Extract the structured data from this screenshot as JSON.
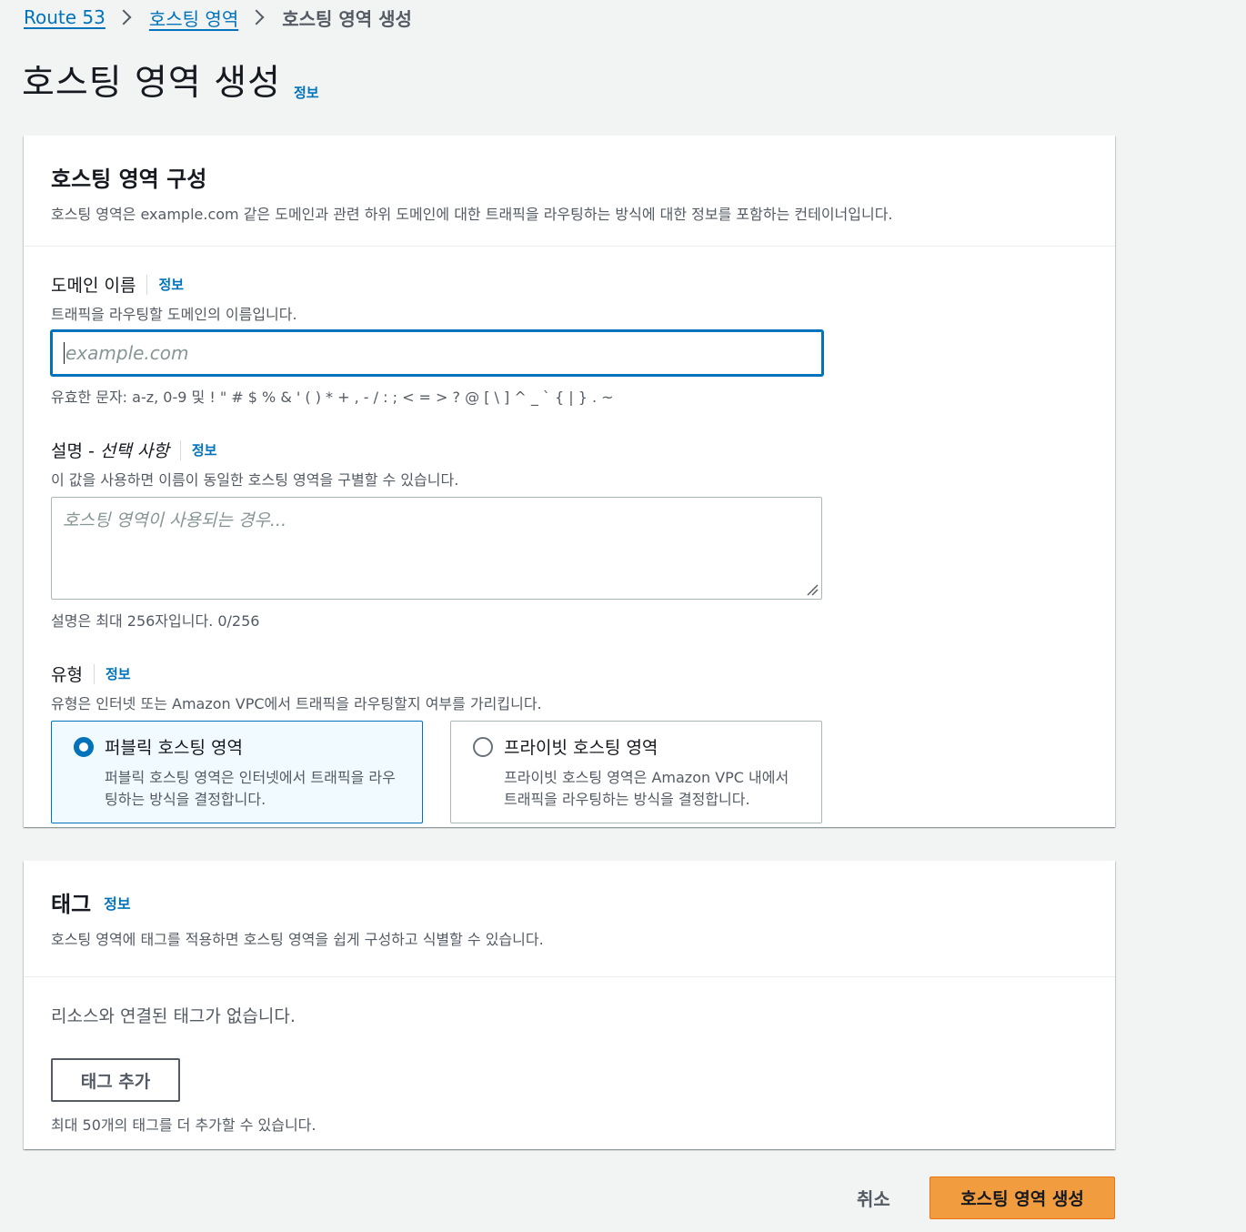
{
  "breadcrumb": {
    "items": [
      {
        "label": "Route 53"
      },
      {
        "label": "호스팅 영역"
      }
    ],
    "current": "호스팅 영역 생성"
  },
  "page": {
    "title": "호스팅 영역 생성",
    "info": "정보"
  },
  "config_panel": {
    "title": "호스팅 영역 구성",
    "description": "호스팅 영역은 example.com 같은 도메인과 관련 하위 도메인에 대한 트래픽을 라우팅하는 방식에 대한 정보를 포함하는 컨테이너입니다.",
    "domain": {
      "label": "도메인 이름",
      "info": "정보",
      "description": "트래픽을 라우팅할 도메인의 이름입니다.",
      "value": "",
      "placeholder": "example.com",
      "constraint": "유효한 문자: a-z, 0-9 및 ! \" # $ % & ' ( ) * + , - / : ; < = > ? @ [ \\ ] ^ _ ` { | } . ~"
    },
    "comment": {
      "label": "설명 -",
      "optional": "선택 사항",
      "info": "정보",
      "description": "이 값을 사용하면 이름이 동일한 호스팅 영역을 구별할 수 있습니다.",
      "placeholder": "호스팅 영역이 사용되는 경우...",
      "constraint": "설명은 최대 256자입니다. 0/256"
    },
    "type": {
      "label": "유형",
      "info": "정보",
      "description": "유형은 인터넷 또는 Amazon VPC에서 트래픽을 라우팅할지 여부를 가리킵니다.",
      "options": [
        {
          "label": "퍼블릭 호스팅 영역",
          "description": "퍼블릭 호스팅 영역은 인터넷에서 트래픽을 라우팅하는 방식을 결정합니다.",
          "selected": true
        },
        {
          "label": "프라이빗 호스팅 영역",
          "description": "프라이빗 호스팅 영역은 Amazon VPC 내에서 트래픽을 라우팅하는 방식을 결정합니다.",
          "selected": false
        }
      ]
    }
  },
  "tags_panel": {
    "title": "태그",
    "info": "정보",
    "description": "호스팅 영역에 태그를 적용하면 호스팅 영역을 쉽게 구성하고 식별할 수 있습니다.",
    "empty_text": "리소스와 연결된 태그가 없습니다.",
    "add_button": "태그 추가",
    "limit_text": "최대 50개의 태그를 더 추가할 수 있습니다."
  },
  "footer": {
    "cancel": "취소",
    "submit": "호스팅 영역 생성"
  },
  "colors": {
    "link": "#0073bb",
    "primary_button": "#f19d3f",
    "selected_tile_bg": "#f1faff"
  }
}
